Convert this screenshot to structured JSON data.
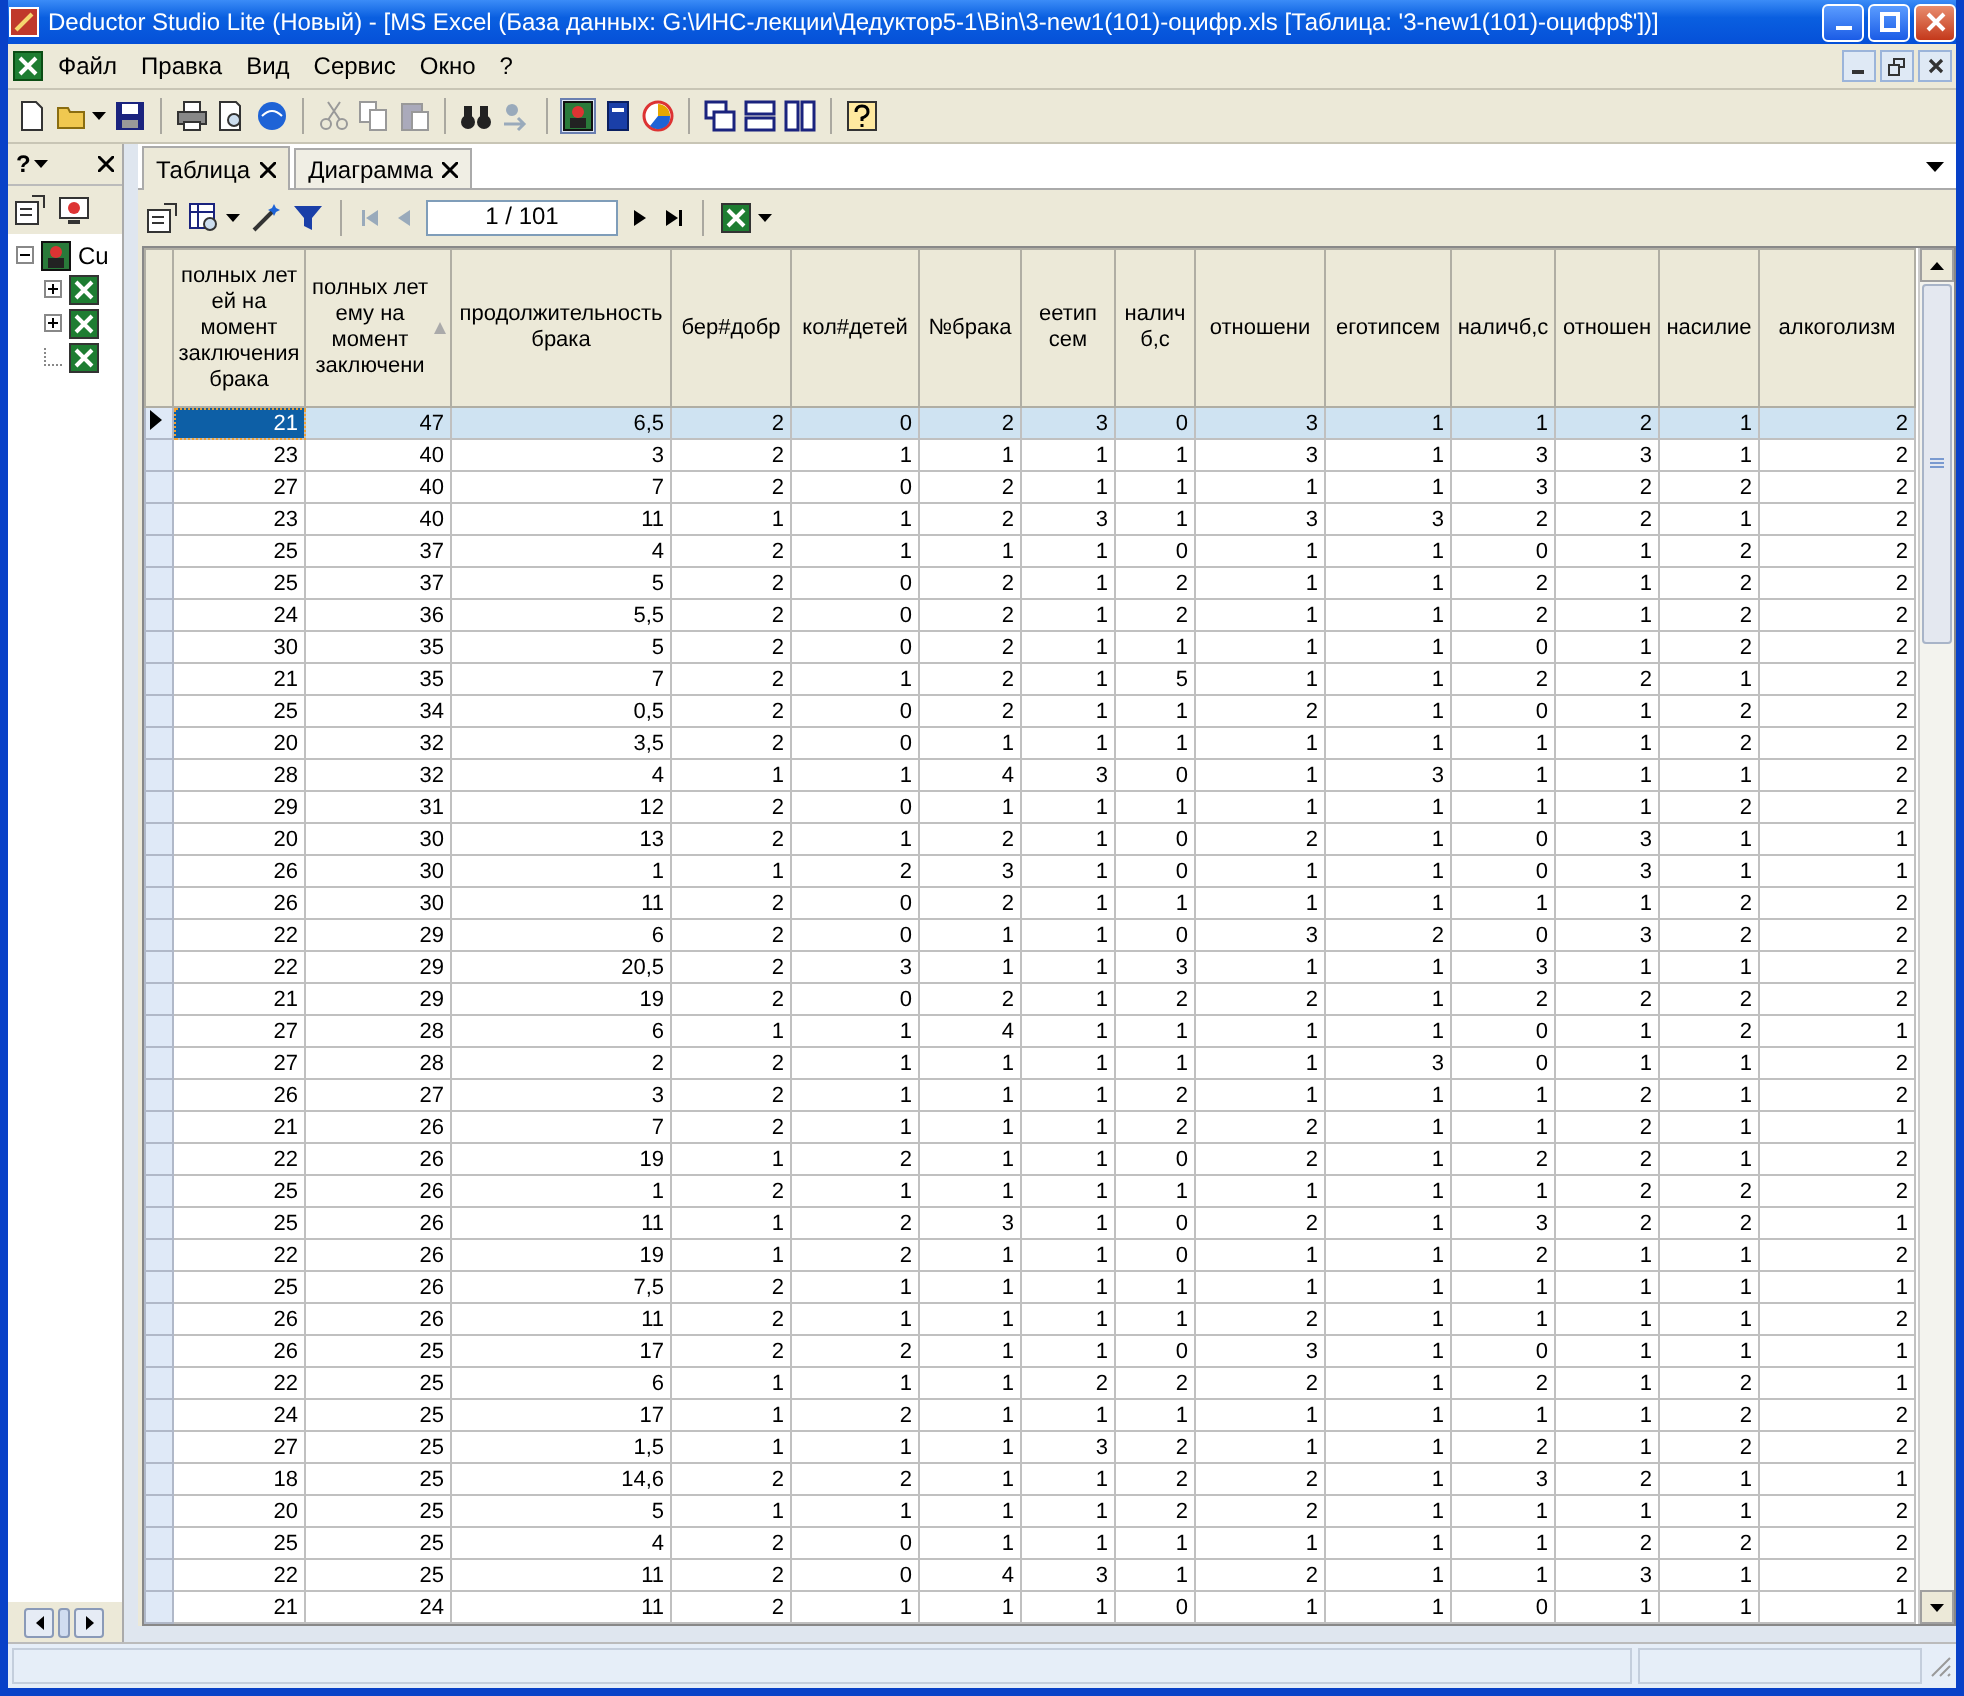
{
  "window": {
    "title": "Deductor Studio Lite (Новый) - [MS Excel (База данных: G:\\ИНС-лекции\\Дедуктор5-1\\Bin\\3-new1(101)-оцифр.xls [Таблица: '3-new1(101)-оцифр$'])]"
  },
  "menu": [
    "Файл",
    "Правка",
    "Вид",
    "Сервис",
    "Окно",
    "?"
  ],
  "side_panel": {
    "help": "?",
    "tree": {
      "label": "Cu",
      "expanded": true,
      "children": [
        {
          "kind": "branch",
          "expanded": false
        },
        {
          "kind": "branch",
          "expanded": false
        },
        {
          "kind": "leaf"
        }
      ]
    }
  },
  "tabs": [
    {
      "label": "Таблица",
      "selected": true
    },
    {
      "label": "Диаграмма",
      "selected": false
    }
  ],
  "pager": {
    "position": "1 / 101"
  },
  "grid": {
    "columns": [
      {
        "header": "полных лет ей на момент заключения брака",
        "sorted": false
      },
      {
        "header": "полных лет ему на момент заключени",
        "sorted": true
      },
      {
        "header": "продолжительность брака",
        "sorted": false
      },
      {
        "header": "бер#добр",
        "sorted": false
      },
      {
        "header": "кол#детей",
        "sorted": false
      },
      {
        "header": "№брака",
        "sorted": false
      },
      {
        "header": "еетип сем",
        "sorted": false
      },
      {
        "header": "налич б,с",
        "sorted": false
      },
      {
        "header": "отношени",
        "sorted": false
      },
      {
        "header": "еготипсем",
        "sorted": false
      },
      {
        "header": "наличб,с",
        "sorted": false
      },
      {
        "header": "отношен",
        "sorted": false
      },
      {
        "header": "насилие",
        "sorted": false
      },
      {
        "header": "алкоголизм",
        "sorted": false
      }
    ],
    "rows": [
      {
        "selected": true,
        "cells": [
          "21",
          "47",
          "6,5",
          "2",
          "0",
          "2",
          "3",
          "0",
          "3",
          "1",
          "1",
          "2",
          "1",
          "2"
        ]
      },
      {
        "selected": false,
        "cells": [
          "23",
          "40",
          "3",
          "2",
          "1",
          "1",
          "1",
          "1",
          "3",
          "1",
          "3",
          "3",
          "1",
          "2"
        ]
      },
      {
        "selected": false,
        "cells": [
          "27",
          "40",
          "7",
          "2",
          "0",
          "2",
          "1",
          "1",
          "1",
          "1",
          "3",
          "2",
          "2",
          "2"
        ]
      },
      {
        "selected": false,
        "cells": [
          "23",
          "40",
          "11",
          "1",
          "1",
          "2",
          "3",
          "1",
          "3",
          "3",
          "2",
          "2",
          "1",
          "2"
        ]
      },
      {
        "selected": false,
        "cells": [
          "25",
          "37",
          "4",
          "2",
          "1",
          "1",
          "1",
          "0",
          "1",
          "1",
          "0",
          "1",
          "2",
          "2"
        ]
      },
      {
        "selected": false,
        "cells": [
          "25",
          "37",
          "5",
          "2",
          "0",
          "2",
          "1",
          "2",
          "1",
          "1",
          "2",
          "1",
          "2",
          "2"
        ]
      },
      {
        "selected": false,
        "cells": [
          "24",
          "36",
          "5,5",
          "2",
          "0",
          "2",
          "1",
          "2",
          "1",
          "1",
          "2",
          "1",
          "2",
          "2"
        ]
      },
      {
        "selected": false,
        "cells": [
          "30",
          "35",
          "5",
          "2",
          "0",
          "2",
          "1",
          "1",
          "1",
          "1",
          "0",
          "1",
          "2",
          "2"
        ]
      },
      {
        "selected": false,
        "cells": [
          "21",
          "35",
          "7",
          "2",
          "1",
          "2",
          "1",
          "5",
          "1",
          "1",
          "2",
          "2",
          "1",
          "2"
        ]
      },
      {
        "selected": false,
        "cells": [
          "25",
          "34",
          "0,5",
          "2",
          "0",
          "2",
          "1",
          "1",
          "2",
          "1",
          "0",
          "1",
          "2",
          "2"
        ]
      },
      {
        "selected": false,
        "cells": [
          "20",
          "32",
          "3,5",
          "2",
          "0",
          "1",
          "1",
          "1",
          "1",
          "1",
          "1",
          "1",
          "2",
          "2"
        ]
      },
      {
        "selected": false,
        "cells": [
          "28",
          "32",
          "4",
          "1",
          "1",
          "4",
          "3",
          "0",
          "1",
          "3",
          "1",
          "1",
          "1",
          "2"
        ]
      },
      {
        "selected": false,
        "cells": [
          "29",
          "31",
          "12",
          "2",
          "0",
          "1",
          "1",
          "1",
          "1",
          "1",
          "1",
          "1",
          "2",
          "2"
        ]
      },
      {
        "selected": false,
        "cells": [
          "20",
          "30",
          "13",
          "2",
          "1",
          "2",
          "1",
          "0",
          "2",
          "1",
          "0",
          "3",
          "1",
          "1"
        ]
      },
      {
        "selected": false,
        "cells": [
          "26",
          "30",
          "1",
          "1",
          "2",
          "3",
          "1",
          "0",
          "1",
          "1",
          "0",
          "3",
          "1",
          "1"
        ]
      },
      {
        "selected": false,
        "cells": [
          "26",
          "30",
          "11",
          "2",
          "0",
          "2",
          "1",
          "1",
          "1",
          "1",
          "1",
          "1",
          "2",
          "2"
        ]
      },
      {
        "selected": false,
        "cells": [
          "22",
          "29",
          "6",
          "2",
          "0",
          "1",
          "1",
          "0",
          "3",
          "2",
          "0",
          "3",
          "2",
          "2"
        ]
      },
      {
        "selected": false,
        "cells": [
          "22",
          "29",
          "20,5",
          "2",
          "3",
          "1",
          "1",
          "3",
          "1",
          "1",
          "3",
          "1",
          "1",
          "2"
        ]
      },
      {
        "selected": false,
        "cells": [
          "21",
          "29",
          "19",
          "2",
          "0",
          "2",
          "1",
          "2",
          "2",
          "1",
          "2",
          "2",
          "2",
          "2"
        ]
      },
      {
        "selected": false,
        "cells": [
          "27",
          "28",
          "6",
          "1",
          "1",
          "4",
          "1",
          "1",
          "1",
          "1",
          "0",
          "1",
          "2",
          "1"
        ]
      },
      {
        "selected": false,
        "cells": [
          "27",
          "28",
          "2",
          "2",
          "1",
          "1",
          "1",
          "1",
          "1",
          "3",
          "0",
          "1",
          "1",
          "2"
        ]
      },
      {
        "selected": false,
        "cells": [
          "26",
          "27",
          "3",
          "2",
          "1",
          "1",
          "1",
          "2",
          "1",
          "1",
          "1",
          "2",
          "1",
          "2"
        ]
      },
      {
        "selected": false,
        "cells": [
          "21",
          "26",
          "7",
          "2",
          "1",
          "1",
          "1",
          "2",
          "2",
          "1",
          "1",
          "2",
          "1",
          "1"
        ]
      },
      {
        "selected": false,
        "cells": [
          "22",
          "26",
          "19",
          "1",
          "2",
          "1",
          "1",
          "0",
          "2",
          "1",
          "2",
          "2",
          "1",
          "2"
        ]
      },
      {
        "selected": false,
        "cells": [
          "25",
          "26",
          "1",
          "2",
          "1",
          "1",
          "1",
          "1",
          "1",
          "1",
          "1",
          "2",
          "2",
          "2"
        ]
      },
      {
        "selected": false,
        "cells": [
          "25",
          "26",
          "11",
          "1",
          "2",
          "3",
          "1",
          "0",
          "2",
          "1",
          "3",
          "2",
          "2",
          "1"
        ]
      },
      {
        "selected": false,
        "cells": [
          "22",
          "26",
          "19",
          "1",
          "2",
          "1",
          "1",
          "0",
          "1",
          "1",
          "2",
          "1",
          "1",
          "2"
        ]
      },
      {
        "selected": false,
        "cells": [
          "25",
          "26",
          "7,5",
          "2",
          "1",
          "1",
          "1",
          "1",
          "1",
          "1",
          "1",
          "1",
          "1",
          "1"
        ]
      },
      {
        "selected": false,
        "cells": [
          "26",
          "26",
          "11",
          "2",
          "1",
          "1",
          "1",
          "1",
          "2",
          "1",
          "1",
          "1",
          "1",
          "2"
        ]
      },
      {
        "selected": false,
        "cells": [
          "26",
          "25",
          "17",
          "2",
          "2",
          "1",
          "1",
          "0",
          "3",
          "1",
          "0",
          "1",
          "1",
          "1"
        ]
      },
      {
        "selected": false,
        "cells": [
          "22",
          "25",
          "6",
          "1",
          "1",
          "1",
          "2",
          "2",
          "2",
          "1",
          "2",
          "1",
          "2",
          "1"
        ]
      },
      {
        "selected": false,
        "cells": [
          "24",
          "25",
          "17",
          "1",
          "2",
          "1",
          "1",
          "1",
          "1",
          "1",
          "1",
          "1",
          "2",
          "2"
        ]
      },
      {
        "selected": false,
        "cells": [
          "27",
          "25",
          "1,5",
          "1",
          "1",
          "1",
          "3",
          "2",
          "1",
          "1",
          "2",
          "1",
          "2",
          "2"
        ]
      },
      {
        "selected": false,
        "cells": [
          "18",
          "25",
          "14,6",
          "2",
          "2",
          "1",
          "1",
          "2",
          "2",
          "1",
          "3",
          "2",
          "1",
          "1"
        ]
      },
      {
        "selected": false,
        "cells": [
          "20",
          "25",
          "5",
          "1",
          "1",
          "1",
          "1",
          "2",
          "2",
          "1",
          "1",
          "1",
          "1",
          "2"
        ]
      },
      {
        "selected": false,
        "cells": [
          "25",
          "25",
          "4",
          "2",
          "0",
          "1",
          "1",
          "1",
          "1",
          "1",
          "1",
          "2",
          "2",
          "2"
        ]
      },
      {
        "selected": false,
        "cells": [
          "22",
          "25",
          "11",
          "2",
          "0",
          "4",
          "3",
          "1",
          "2",
          "1",
          "1",
          "3",
          "1",
          "2"
        ]
      },
      {
        "selected": false,
        "cells": [
          "21",
          "24",
          "11",
          "2",
          "1",
          "1",
          "1",
          "0",
          "1",
          "1",
          "0",
          "1",
          "1",
          "1"
        ]
      }
    ]
  }
}
